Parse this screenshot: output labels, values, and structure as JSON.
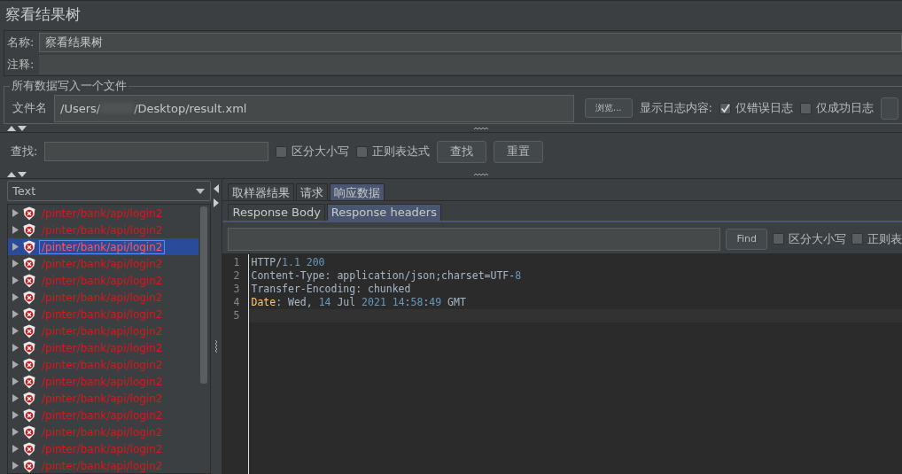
{
  "title": "察看结果树",
  "name_field": {
    "label": "名称:",
    "value": "察看结果树"
  },
  "comment_field": {
    "label": "注释:"
  },
  "file_group": {
    "legend": "所有数据写入一个文件",
    "label": "文件名",
    "path_start": "/Users/",
    "path_end": "/Desktop/result.xml",
    "browse": "浏览...",
    "log_label": "显示日志内容:",
    "options": [
      {
        "label": "仅错误日志",
        "checked": true
      },
      {
        "label": "仅成功日志",
        "checked": false
      }
    ]
  },
  "search": {
    "label": "查找:",
    "options": [
      {
        "label": "区分大小写",
        "checked": false
      },
      {
        "label": "正则表达式",
        "checked": false
      }
    ],
    "buttons": [
      "查找",
      "重置"
    ]
  },
  "renderer": {
    "value": "Text"
  },
  "tree": [
    {
      "label": "/pinter/bank/api/login2",
      "selected": false
    },
    {
      "label": "/pinter/bank/api/login2",
      "selected": false
    },
    {
      "label": "/pinter/bank/api/login2",
      "selected": true
    },
    {
      "label": "/pinter/bank/api/login2",
      "selected": false
    },
    {
      "label": "/pinter/bank/api/login2",
      "selected": false
    },
    {
      "label": "/pinter/bank/api/login2",
      "selected": false
    },
    {
      "label": "/pinter/bank/api/login2",
      "selected": false
    },
    {
      "label": "/pinter/bank/api/login2",
      "selected": false
    },
    {
      "label": "/pinter/bank/api/login2",
      "selected": false
    },
    {
      "label": "/pinter/bank/api/login2",
      "selected": false
    },
    {
      "label": "/pinter/bank/api/login2",
      "selected": false
    },
    {
      "label": "/pinter/bank/api/login2",
      "selected": false
    },
    {
      "label": "/pinter/bank/api/login2",
      "selected": false
    },
    {
      "label": "/pinter/bank/api/login2",
      "selected": false
    },
    {
      "label": "/pinter/bank/api/login2",
      "selected": false
    },
    {
      "label": "/pinter/bank/api/login2",
      "selected": false
    }
  ],
  "tabs": [
    {
      "label": "取样器结果",
      "selected": false
    },
    {
      "label": "请求",
      "selected": false
    },
    {
      "label": "响应数据",
      "selected": true
    }
  ],
  "subtabs": [
    {
      "label": "Response Body",
      "selected": false
    },
    {
      "label": "Response headers",
      "selected": true
    }
  ],
  "find": {
    "button": "Find",
    "options": [
      {
        "label": "区分大小写",
        "checked": false
      },
      {
        "label": "正则表",
        "checked": false
      }
    ]
  },
  "code": [
    {
      "number": "1",
      "tokens": [
        {
          "kind": "plain",
          "text": "HTTP/"
        },
        {
          "kind": "number",
          "text": "1.1 200"
        }
      ]
    },
    {
      "number": "2",
      "tokens": [
        {
          "kind": "plain",
          "text": "Content-Type: application/json;charset=UTF-"
        },
        {
          "kind": "number",
          "text": "8"
        }
      ]
    },
    {
      "number": "3",
      "tokens": [
        {
          "kind": "plain",
          "text": "Transfer-Encoding: chunked"
        }
      ]
    },
    {
      "number": "4",
      "tokens": [
        {
          "kind": "key",
          "text": "Date"
        },
        {
          "kind": "plain",
          "text": ": Wed, "
        },
        {
          "kind": "number",
          "text": "14"
        },
        {
          "kind": "plain",
          "text": " Jul "
        },
        {
          "kind": "number",
          "text": "2021 14"
        },
        {
          "kind": "plain",
          "text": ":"
        },
        {
          "kind": "number",
          "text": "58"
        },
        {
          "kind": "plain",
          "text": ":"
        },
        {
          "kind": "number",
          "text": "49"
        },
        {
          "kind": "plain",
          "text": " GMT"
        }
      ]
    },
    {
      "number": "5"
    }
  ]
}
